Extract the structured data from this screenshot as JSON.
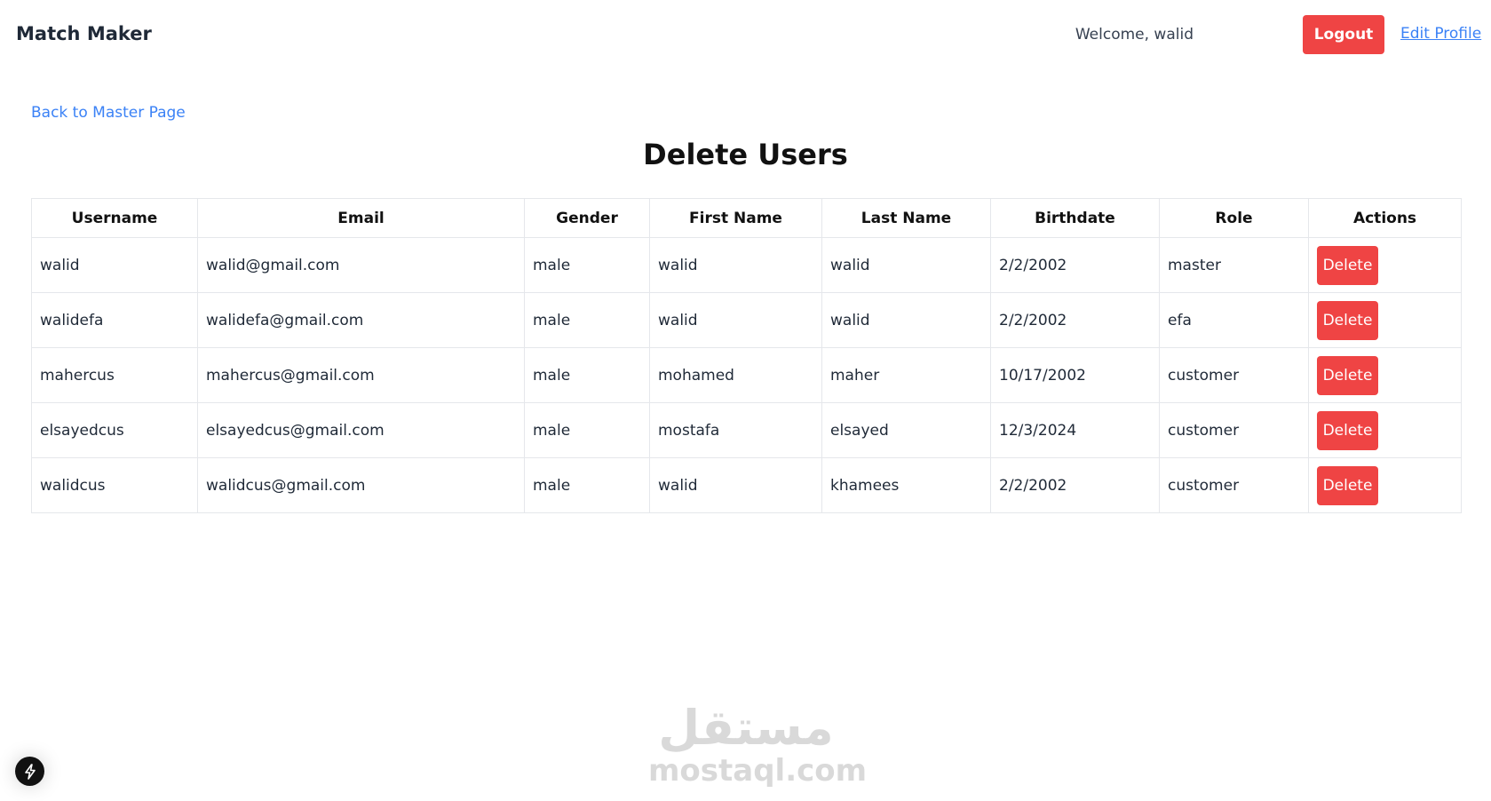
{
  "navbar": {
    "brand": "Match Maker",
    "welcome_text": "Welcome, walid",
    "logout_label": "Logout",
    "edit_profile_label": "Edit Profile"
  },
  "back_link": "Back to Master Page",
  "page_title": "Delete Users",
  "table": {
    "headers": [
      "Username",
      "Email",
      "Gender",
      "First Name",
      "Last Name",
      "Birthdate",
      "Role",
      "Actions"
    ],
    "rows": [
      {
        "username": "walid",
        "email": "walid@gmail.com",
        "gender": "male",
        "first_name": "walid",
        "last_name": "walid",
        "birthdate": "2/2/2002",
        "role": "master",
        "action": "Delete"
      },
      {
        "username": "walidefa",
        "email": "walidefa@gmail.com",
        "gender": "male",
        "first_name": "walid",
        "last_name": "walid",
        "birthdate": "2/2/2002",
        "role": "efa",
        "action": "Delete"
      },
      {
        "username": "mahercus",
        "email": "mahercus@gmail.com",
        "gender": "male",
        "first_name": "mohamed",
        "last_name": "maher",
        "birthdate": "10/17/2002",
        "role": "customer",
        "action": "Delete"
      },
      {
        "username": "elsayedcus",
        "email": "elsayedcus@gmail.com",
        "gender": "male",
        "first_name": "mostafa",
        "last_name": "elsayed",
        "birthdate": "12/3/2024",
        "role": "customer",
        "action": "Delete"
      },
      {
        "username": "walidcus",
        "email": "walidcus@gmail.com",
        "gender": "male",
        "first_name": "walid",
        "last_name": "khamees",
        "birthdate": "2/2/2002",
        "role": "customer",
        "action": "Delete"
      }
    ]
  },
  "watermark": {
    "arabic": "مستقل",
    "latin": "mostaql.com"
  },
  "colors": {
    "danger": "#ef4444",
    "link": "#3b82f6",
    "border": "#e5e7eb"
  },
  "icons": {
    "dev_indicator": "lightning-bolt-icon"
  }
}
